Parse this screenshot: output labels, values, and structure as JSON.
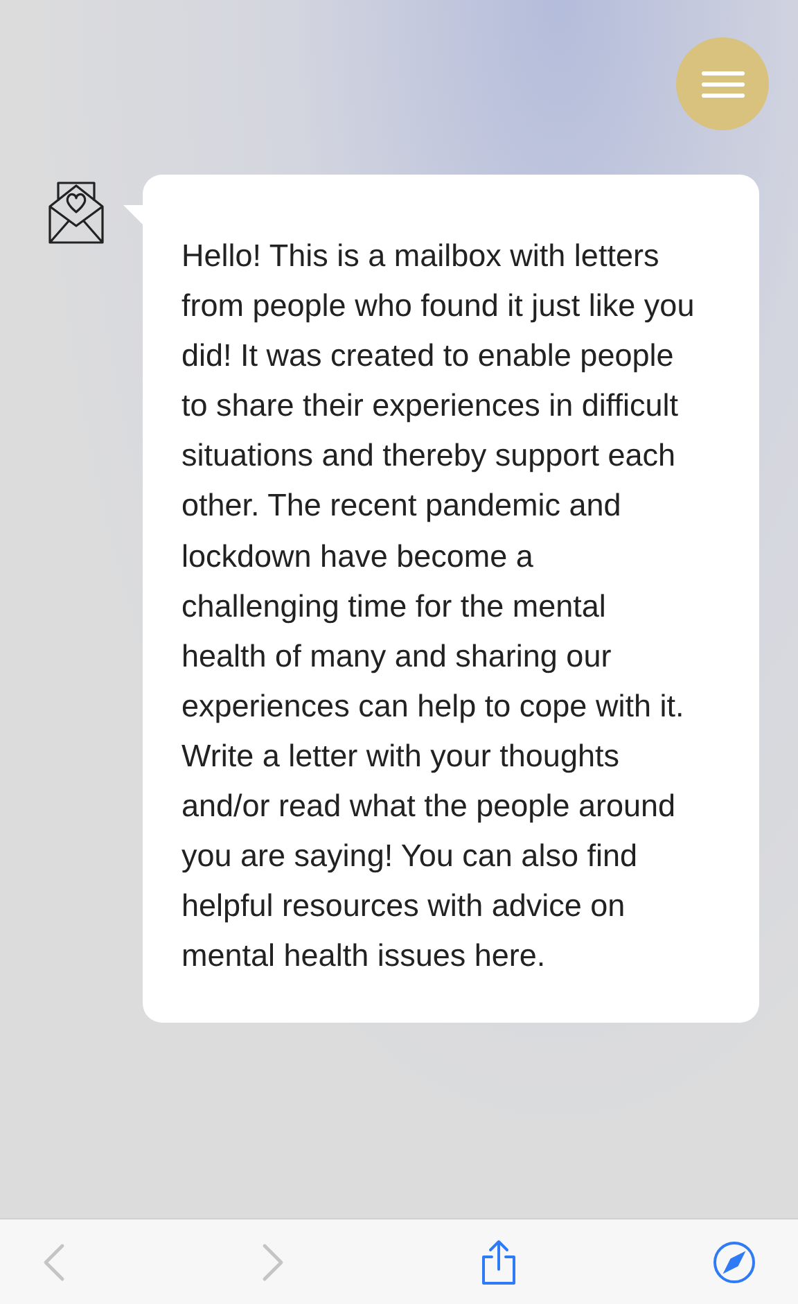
{
  "menu_button": {
    "kind": "hamburger"
  },
  "message": {
    "text": "Hello! This is a mailbox with letters from people who found it just like you did! It was created to enable people to share their experiences in difficult situations and thereby support each other. The recent pandemic and lockdown have become a challenging time for the mental health of many and sharing our experiences can help to cope with it. Write a letter with your thoughts and/or read what the people around you are saying! You can also find helpful resources with advice on mental health issues here."
  },
  "toolbar": {
    "back_disabled": true,
    "forward_disabled": true
  }
}
